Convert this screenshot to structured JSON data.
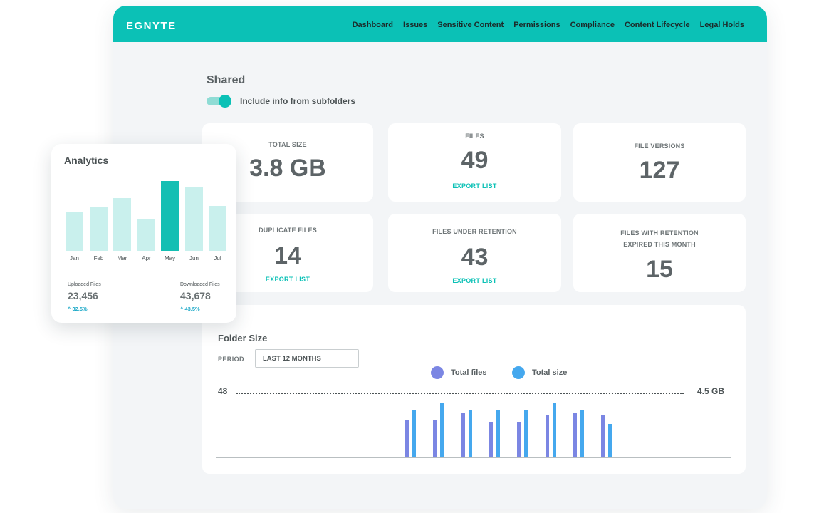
{
  "brand": {
    "logo": "EGNYTE",
    "accent": "#0bc1b6"
  },
  "nav": [
    "Dashboard",
    "Issues",
    "Sensitive Content",
    "Permissions",
    "Compliance",
    "Content Lifecycle",
    "Legal Holds"
  ],
  "page": {
    "title": "Shared",
    "toggle_label": "Include info from subfolders",
    "toggle_on": true
  },
  "cards": {
    "total_size": {
      "label": "TOTAL SIZE",
      "value": "3.8 GB"
    },
    "files": {
      "label": "FILES",
      "value": "49",
      "link": "EXPORT LIST"
    },
    "file_versions": {
      "label": "FILE VERSIONS",
      "value": "127"
    },
    "duplicate_files": {
      "label": "DUPLICATE FILES",
      "value": "14",
      "link": "EXPORT LIST"
    },
    "files_under_retention": {
      "label": "FILES UNDER RETENTION",
      "value": "43",
      "link": "EXPORT LIST"
    },
    "retention_expired": {
      "label_line1": "FILES WITH RETENTION",
      "label_line2": "EXPIRED THIS MONTH",
      "value": "15"
    }
  },
  "folder_size": {
    "title": "Folder Size",
    "period_label": "PERIOD",
    "period_value": "LAST 12 MONTHS",
    "legend": [
      {
        "name": "Total files",
        "color": "#7b86e3"
      },
      {
        "name": "Total size",
        "color": "#45a8ee"
      }
    ],
    "left_axis_max": "48",
    "right_axis_max": "4.5 GB"
  },
  "chart_data": [
    {
      "type": "bar",
      "title": "Folder Size",
      "series": [
        {
          "name": "Total files",
          "values": [
            38,
            38,
            46,
            37,
            37,
            43,
            46,
            43
          ],
          "color": "#7b86e3"
        },
        {
          "name": "Total size",
          "values": [
            4.6,
            5.2,
            4.6,
            4.6,
            4.6,
            5.2,
            4.6,
            3.2
          ],
          "color": "#45a8ee"
        }
      ],
      "left_ylim": [
        0,
        110
      ],
      "right_ylim": [
        0,
        10.3
      ]
    },
    {
      "type": "bar",
      "title": "Analytics",
      "categories": [
        "Jan",
        "Feb",
        "Mar",
        "Apr",
        "May",
        "Jun",
        "Jul"
      ],
      "values": [
        55,
        62,
        74,
        45,
        98,
        89,
        63
      ],
      "highlight_index": 4,
      "ylim": [
        0,
        100
      ],
      "colors": {
        "normal": "#c9f0ed",
        "highlight": "#14bfb3"
      }
    }
  ],
  "analytics": {
    "title": "Analytics",
    "uploaded": {
      "label": "Uploaded Files",
      "value": "23,456",
      "delta": "^ 32.5%"
    },
    "downloaded": {
      "label": "Downloaded Files",
      "value": "43,678",
      "delta": "^ 43.5%"
    }
  }
}
